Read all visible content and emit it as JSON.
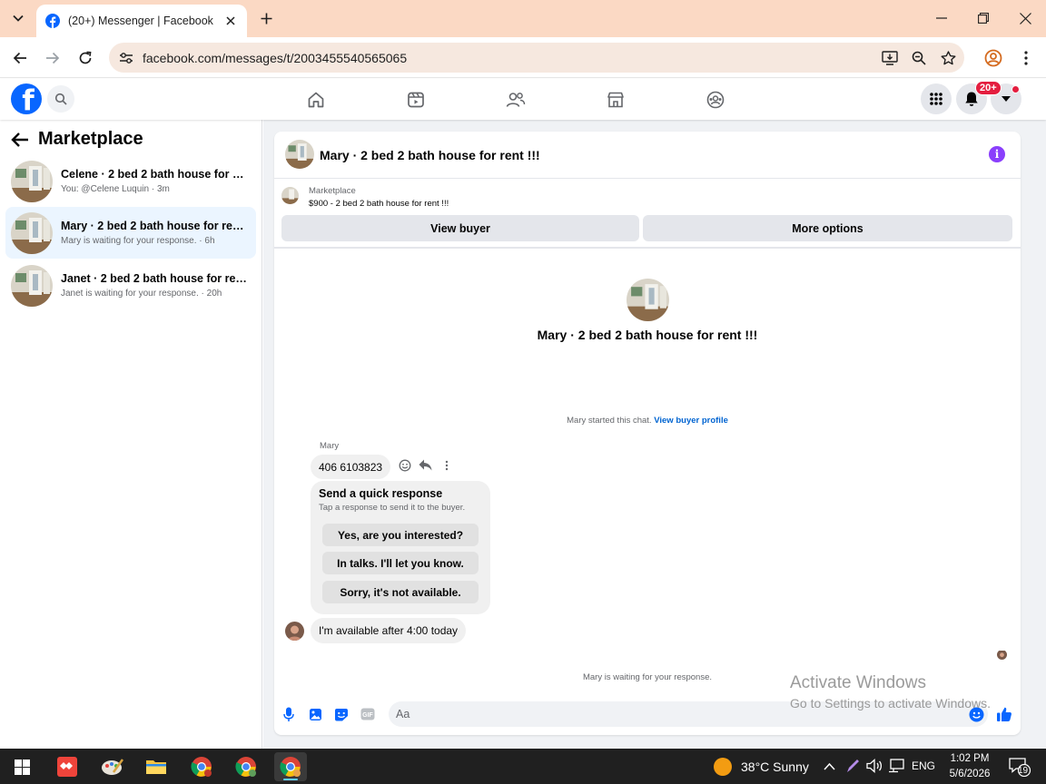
{
  "browser": {
    "tab_title": "(20+) Messenger | Facebook",
    "url": "facebook.com/messages/t/2003455540565065"
  },
  "facebook": {
    "logo_letter": "f",
    "notification_badge": "20+"
  },
  "sidebar": {
    "title": "Marketplace",
    "conversations": [
      {
        "title": "Celene · 2 bed 2 bath house for re...",
        "subtitle": "You: @Celene Luquin · 3m",
        "active": false
      },
      {
        "title": "Mary · 2 bed 2 bath house for rent...",
        "subtitle": "Mary is waiting for your response. · 6h",
        "active": true
      },
      {
        "title": "Janet · 2 bed 2 bath house for rent...",
        "subtitle": "Janet is waiting for your response. · 20h",
        "active": false
      }
    ]
  },
  "chat": {
    "header_title": "Mary · 2 bed 2 bath house for rent !!!",
    "listing_label": "Marketplace",
    "listing_price": "$900 - 2 bed 2 bath house for rent !!!",
    "view_buyer": "View buyer",
    "more_options": "More options",
    "intro_title": "Mary · 2 bed 2 bath house for rent !!!",
    "started_text": "Mary started this chat.",
    "started_link": "View buyer profile",
    "sender_name": "Mary",
    "message_1": "406 6103823",
    "quick_title": "Send a quick response",
    "quick_sub": "Tap a response to send it to the buyer.",
    "quick_options": [
      "Yes, are you interested?",
      "In talks. I'll let you know.",
      "Sorry, it's not available."
    ],
    "message_2": "I'm available after 4:00 today",
    "waiting_text": "Mary is waiting for your response.",
    "composer_placeholder": "Aa"
  },
  "watermark": {
    "line1": "Activate Windows",
    "line2": "Go to Settings to activate Windows."
  },
  "taskbar": {
    "weather": "38°C  Sunny",
    "language": "ENG",
    "time": "1:02 PM",
    "date": "5/6/2026",
    "notification_count": "19"
  },
  "colors": {
    "facebook_blue": "#0866ff",
    "messenger_link": "#0064d1",
    "tab_strip": "#fbd9c4",
    "info_purple": "#8a3ffc",
    "badge_red": "#e41e3f"
  },
  "icons": [
    "tab-search-icon",
    "facebook-favicon",
    "close-icon",
    "plus-icon",
    "minimize-icon",
    "restore-icon",
    "close-window-icon",
    "back-arrow-icon",
    "forward-arrow-icon",
    "reload-icon",
    "site-info-icon",
    "install-icon",
    "zoom-icon",
    "star-icon",
    "profile-icon",
    "kebab-icon",
    "search-icon",
    "home-icon",
    "video-icon",
    "friends-icon",
    "marketplace-icon",
    "groups-icon",
    "grid-menu-icon",
    "bell-icon",
    "caret-down-icon",
    "info-icon",
    "emoji-icon",
    "reply-icon",
    "more-icon",
    "mic-icon",
    "image-icon",
    "sticker-icon",
    "gif-icon",
    "like-icon",
    "windows-icon",
    "weather-icon"
  ]
}
